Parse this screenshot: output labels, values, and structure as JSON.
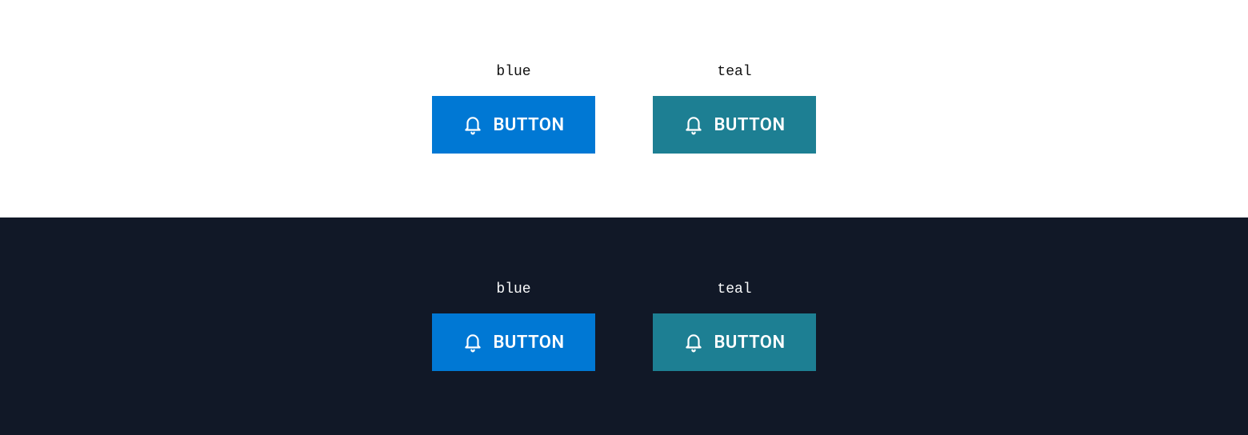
{
  "sections": {
    "light": {
      "items": [
        {
          "caption": "blue",
          "button_label": "BUTTON",
          "color": "#0078d4",
          "icon": "bell"
        },
        {
          "caption": "teal",
          "button_label": "BUTTON",
          "color": "#1d7f93",
          "icon": "bell"
        }
      ]
    },
    "dark": {
      "background": "#111827",
      "items": [
        {
          "caption": "blue",
          "button_label": "BUTTON",
          "color": "#0078d4",
          "icon": "bell"
        },
        {
          "caption": "teal",
          "button_label": "BUTTON",
          "color": "#1d7f93",
          "icon": "bell"
        }
      ]
    }
  }
}
